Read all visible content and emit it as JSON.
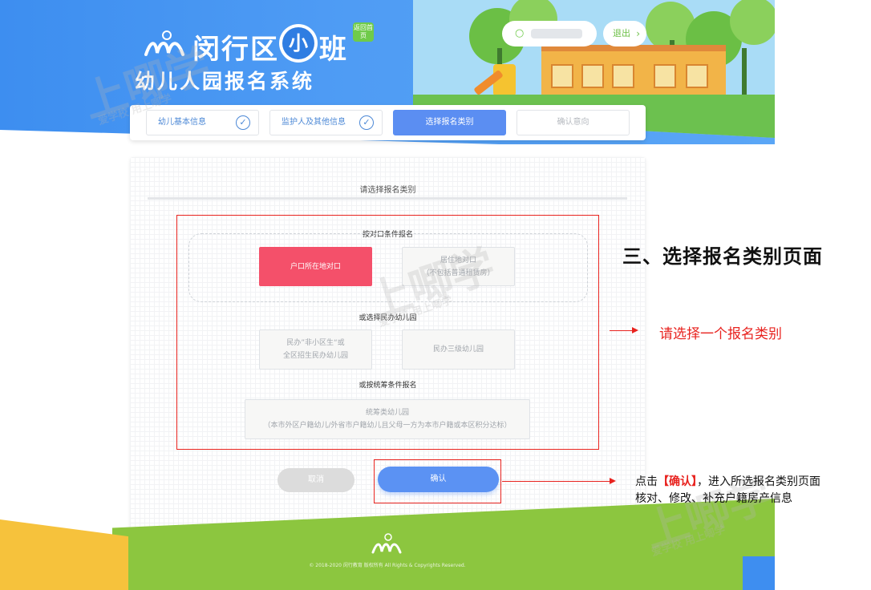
{
  "header": {
    "title_main": "闵行区",
    "badge_small": "小",
    "badge_class": "班",
    "home_badge": "返回首页",
    "subtitle": "幼儿人园报名系统",
    "logout_label": "退出"
  },
  "steps": [
    {
      "label": "幼儿基本信息",
      "state": "done"
    },
    {
      "label": "监护人及其他信息",
      "state": "done"
    },
    {
      "label": "选择报名类别",
      "state": "active"
    },
    {
      "label": "确认意向",
      "state": "pending"
    }
  ],
  "main": {
    "title": "请选择报名类别",
    "section1": {
      "title": "按对口条件报名",
      "options": [
        {
          "line1": "户口所在地对口",
          "line2": "",
          "selected": true
        },
        {
          "line1": "居住地对口",
          "line2": "（不包括普通租赁房）",
          "selected": false
        }
      ]
    },
    "section2": {
      "title": "或选择民办幼儿园",
      "options": [
        {
          "line1": "民办”非小区生“或",
          "line2": "全区招生民办幼儿园",
          "selected": false
        },
        {
          "line1": "民办三级幼儿园",
          "line2": "",
          "selected": false
        }
      ]
    },
    "section3": {
      "title": "或按统筹条件报名",
      "option": {
        "line1": "统筹类幼儿园",
        "line2": "（本市外区户籍幼儿/外省市户籍幼儿且父母一方为本市户籍或本区积分达标）",
        "selected": false
      }
    },
    "cancel_label": "取消",
    "confirm_label": "确认"
  },
  "footer": {
    "copyright": "© 2018-2020 闵行教育 版权所有 All Rights & Copyrights Reserved."
  },
  "watermark": {
    "text": "上唧学",
    "sub": "爱学校 用上唧学"
  },
  "annotations": {
    "page_title": "三、选择报名类别页面",
    "hint": "请选择一个报名类别",
    "confirm_prefix": "点击",
    "confirm_highlight": "【确认】",
    "confirm_suffix": "，进入所选报名类别页面",
    "confirm_line2": "核对、修改、补充户籍房产信息"
  },
  "colors": {
    "header_blue": "#3d8ef0",
    "selected_red": "#f4506a",
    "primary_blue": "#5b92f3",
    "annotation_red": "#e8231f",
    "footer_green": "#8cc63f",
    "footer_yellow": "#f6c23c"
  }
}
